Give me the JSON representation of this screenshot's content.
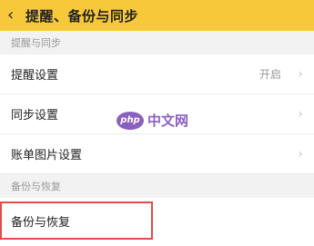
{
  "header": {
    "title": "提醒、备份与同步",
    "back_icon": "chevron-left-icon"
  },
  "sections": {
    "reminder_sync": {
      "title": "提醒与同步",
      "items": [
        {
          "label": "提醒设置",
          "value": "开启"
        },
        {
          "label": "同步设置"
        },
        {
          "label": "账单图片设置"
        }
      ]
    },
    "backup_restore": {
      "title": "备份与恢复",
      "items": [
        {
          "label": "备份与恢复"
        }
      ]
    }
  },
  "watermark": {
    "logo_text": "php",
    "text": "中文网"
  },
  "colors": {
    "header_bg": "#f7c93a",
    "highlight_border": "#e64b4b"
  }
}
